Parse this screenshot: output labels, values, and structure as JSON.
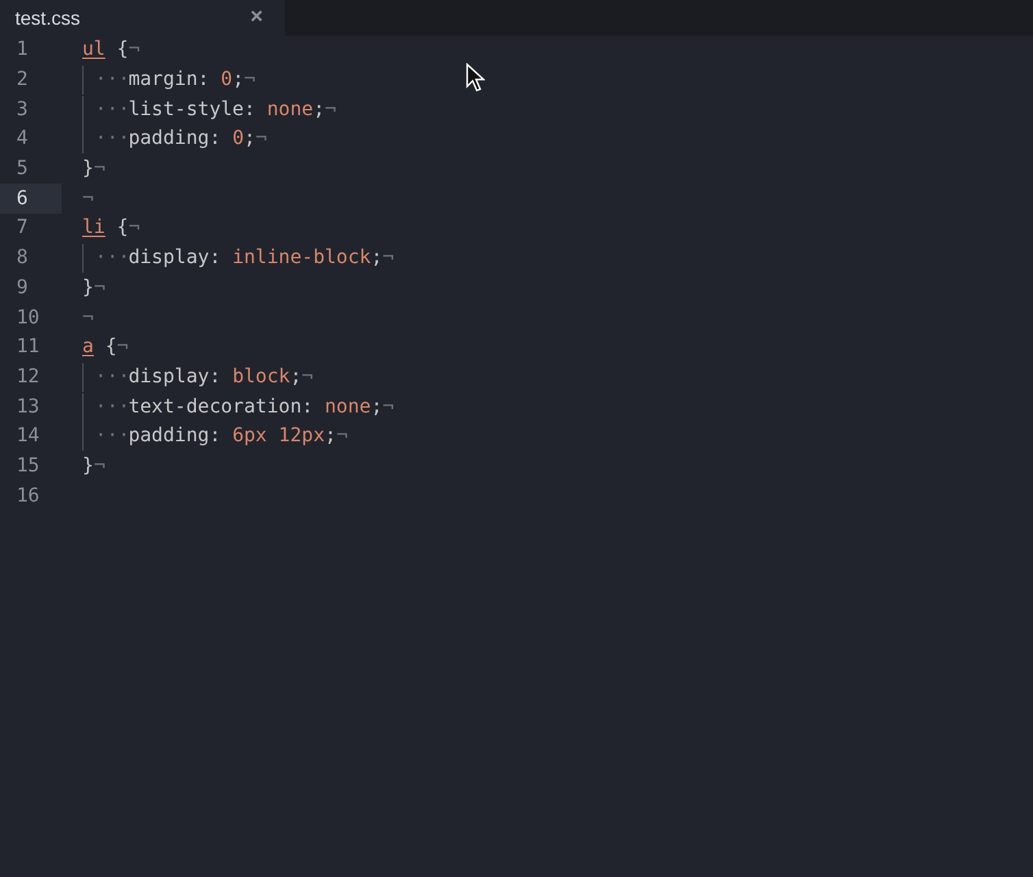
{
  "tabs": [
    {
      "title": "test.css",
      "close": "×",
      "selected": true
    }
  ],
  "lines": [
    {
      "number": "1",
      "current": false,
      "tokens": [
        {
          "kind": "selector",
          "text": "ul"
        },
        {
          "kind": "plain",
          "text": " {"
        },
        {
          "kind": "eol",
          "text": "¬"
        }
      ]
    },
    {
      "number": "2",
      "current": false,
      "tokens": [
        {
          "kind": "indent",
          "text": "···"
        },
        {
          "kind": "plain",
          "text": "margin: "
        },
        {
          "kind": "value",
          "text": "0"
        },
        {
          "kind": "plain",
          "text": ";"
        },
        {
          "kind": "eol",
          "text": "¬"
        }
      ]
    },
    {
      "number": "3",
      "current": false,
      "tokens": [
        {
          "kind": "indent",
          "text": "···"
        },
        {
          "kind": "plain",
          "text": "list-style: "
        },
        {
          "kind": "value",
          "text": "none"
        },
        {
          "kind": "plain",
          "text": ";"
        },
        {
          "kind": "eol",
          "text": "¬"
        }
      ]
    },
    {
      "number": "4",
      "current": false,
      "tokens": [
        {
          "kind": "indent",
          "text": "···"
        },
        {
          "kind": "plain",
          "text": "padding: "
        },
        {
          "kind": "value",
          "text": "0"
        },
        {
          "kind": "plain",
          "text": ";"
        },
        {
          "kind": "eol",
          "text": "¬"
        }
      ]
    },
    {
      "number": "5",
      "current": false,
      "tokens": [
        {
          "kind": "plain",
          "text": "}"
        },
        {
          "kind": "eol",
          "text": "¬"
        }
      ]
    },
    {
      "number": "6",
      "current": true,
      "tokens": [
        {
          "kind": "eol",
          "text": "¬"
        }
      ]
    },
    {
      "number": "7",
      "current": false,
      "tokens": [
        {
          "kind": "selector",
          "text": "li"
        },
        {
          "kind": "plain",
          "text": " {"
        },
        {
          "kind": "eol",
          "text": "¬"
        }
      ]
    },
    {
      "number": "8",
      "current": false,
      "tokens": [
        {
          "kind": "indent",
          "text": "···"
        },
        {
          "kind": "plain",
          "text": "display: "
        },
        {
          "kind": "value",
          "text": "inline-block"
        },
        {
          "kind": "plain",
          "text": ";"
        },
        {
          "kind": "eol",
          "text": "¬"
        }
      ]
    },
    {
      "number": "9",
      "current": false,
      "tokens": [
        {
          "kind": "plain",
          "text": "}"
        },
        {
          "kind": "eol",
          "text": "¬"
        }
      ]
    },
    {
      "number": "10",
      "current": false,
      "tokens": [
        {
          "kind": "eol",
          "text": "¬"
        }
      ]
    },
    {
      "number": "11",
      "current": false,
      "tokens": [
        {
          "kind": "selector",
          "text": "a"
        },
        {
          "kind": "plain",
          "text": " {"
        },
        {
          "kind": "eol",
          "text": "¬"
        }
      ]
    },
    {
      "number": "12",
      "current": false,
      "tokens": [
        {
          "kind": "indent",
          "text": "···"
        },
        {
          "kind": "plain",
          "text": "display: "
        },
        {
          "kind": "value",
          "text": "block"
        },
        {
          "kind": "plain",
          "text": ";"
        },
        {
          "kind": "eol",
          "text": "¬"
        }
      ]
    },
    {
      "number": "13",
      "current": false,
      "tokens": [
        {
          "kind": "indent",
          "text": "···"
        },
        {
          "kind": "plain",
          "text": "text-decoration: "
        },
        {
          "kind": "value",
          "text": "none"
        },
        {
          "kind": "plain",
          "text": ";"
        },
        {
          "kind": "eol",
          "text": "¬"
        }
      ]
    },
    {
      "number": "14",
      "current": false,
      "tokens": [
        {
          "kind": "indent",
          "text": "···"
        },
        {
          "kind": "plain",
          "text": "padding: "
        },
        {
          "kind": "value",
          "text": "6px 12px"
        },
        {
          "kind": "plain",
          "text": ";"
        },
        {
          "kind": "eol",
          "text": "¬"
        }
      ]
    },
    {
      "number": "15",
      "current": false,
      "tokens": [
        {
          "kind": "plain",
          "text": "}"
        },
        {
          "kind": "eol",
          "text": "¬"
        }
      ]
    },
    {
      "number": "16",
      "current": false
    }
  ]
}
